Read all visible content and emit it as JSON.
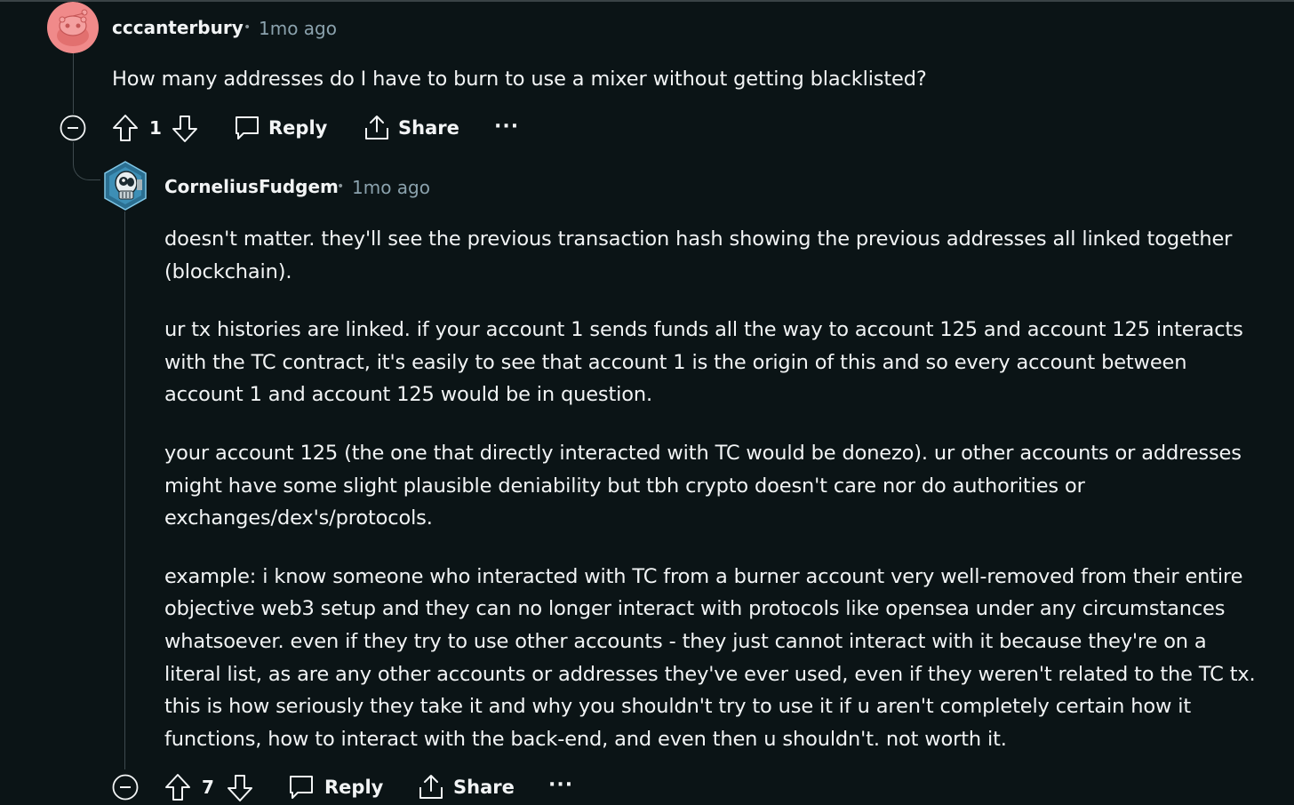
{
  "comments": [
    {
      "author": "cccanterbury",
      "separator": "•",
      "time": "1mo ago",
      "body": [
        "How many addresses do I have to burn to use a mixer without getting blacklisted?"
      ],
      "votes": "1",
      "reply_label": "Reply",
      "share_label": "Share",
      "more_label": "···"
    },
    {
      "author": "CorneliusFudgem",
      "separator": "•",
      "time": "1mo ago",
      "body": [
        "doesn't matter. they'll see the previous transaction hash showing the previous addresses all linked together (blockchain).",
        "ur tx histories are linked. if your account 1 sends funds all the way to account 125 and account 125 interacts with the TC contract, it's easily to see that account 1 is the origin of this and so every account between account 1 and account 125 would be in question.",
        "your account 125 (the one that directly interacted with TC would be donezo). ur other accounts or addresses might have some slight plausible deniability but tbh crypto doesn't care nor do authorities or exchanges/dex's/protocols.",
        "example: i know someone who interacted with TC from a burner account very well-removed from their entire objective web3 setup and they can no longer interact with protocols like opensea under any circumstances whatsoever. even if they try to use other accounts - they just cannot interact with it because they're on a literal list, as are any other accounts or addresses they've ever used, even if they weren't related to the TC tx. this is how seriously they take it and why you shouldn't try to use it if u aren't completely certain how it functions, how to interact with the back-end, and even then u shouldn't. not worth it."
      ],
      "votes": "7",
      "reply_label": "Reply",
      "share_label": "Share",
      "more_label": "···"
    }
  ],
  "colors": {
    "background": "#0b1416",
    "text": "#f2f4f5",
    "meta": "#8ba2ad",
    "thread_line": "#3e4a4e",
    "avatar1_bg": "#f08a8a"
  },
  "icons": [
    "snoo-avatar-icon",
    "robot-avatar-icon",
    "collapse-icon",
    "upvote-icon",
    "downvote-icon",
    "comment-icon",
    "share-icon",
    "more-icon"
  ]
}
